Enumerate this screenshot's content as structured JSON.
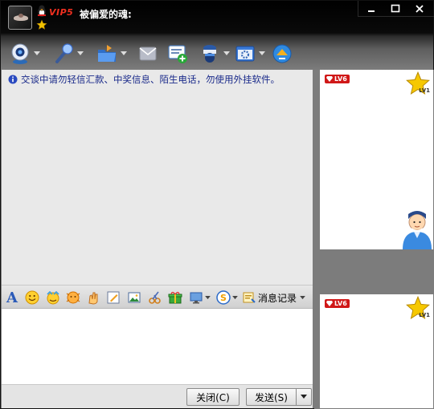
{
  "window": {
    "contact_name": "被偏爱的魂:",
    "vip_badge": "VIP5"
  },
  "toolbar": {
    "items": [
      {
        "name": "video-call",
        "has_dropdown": true
      },
      {
        "name": "voice-call",
        "has_dropdown": true
      },
      {
        "name": "send-file",
        "has_dropdown": true
      },
      {
        "name": "send-sms",
        "has_dropdown": false
      },
      {
        "name": "create-group",
        "has_dropdown": false
      },
      {
        "name": "remote-assist",
        "has_dropdown": true
      },
      {
        "name": "app-settings",
        "has_dropdown": true
      },
      {
        "name": "applications",
        "has_dropdown": false
      }
    ]
  },
  "chat": {
    "notice": "交谈中请勿轻信汇款、中奖信息、陌生电话，勿使用外挂软件。"
  },
  "format_bar": {
    "history_label": "消息记录"
  },
  "bottom": {
    "close_label": "关闭(C)",
    "send_label": "发送(S)"
  },
  "profile": {
    "contact_level": "LV6",
    "contact_star_level": "LV1",
    "self_level": "LV6",
    "self_star_level": "LV1"
  },
  "colors": {
    "notice_text": "#1a2a8a",
    "vip_red": "#f03020",
    "level_badge": "#d01818"
  }
}
